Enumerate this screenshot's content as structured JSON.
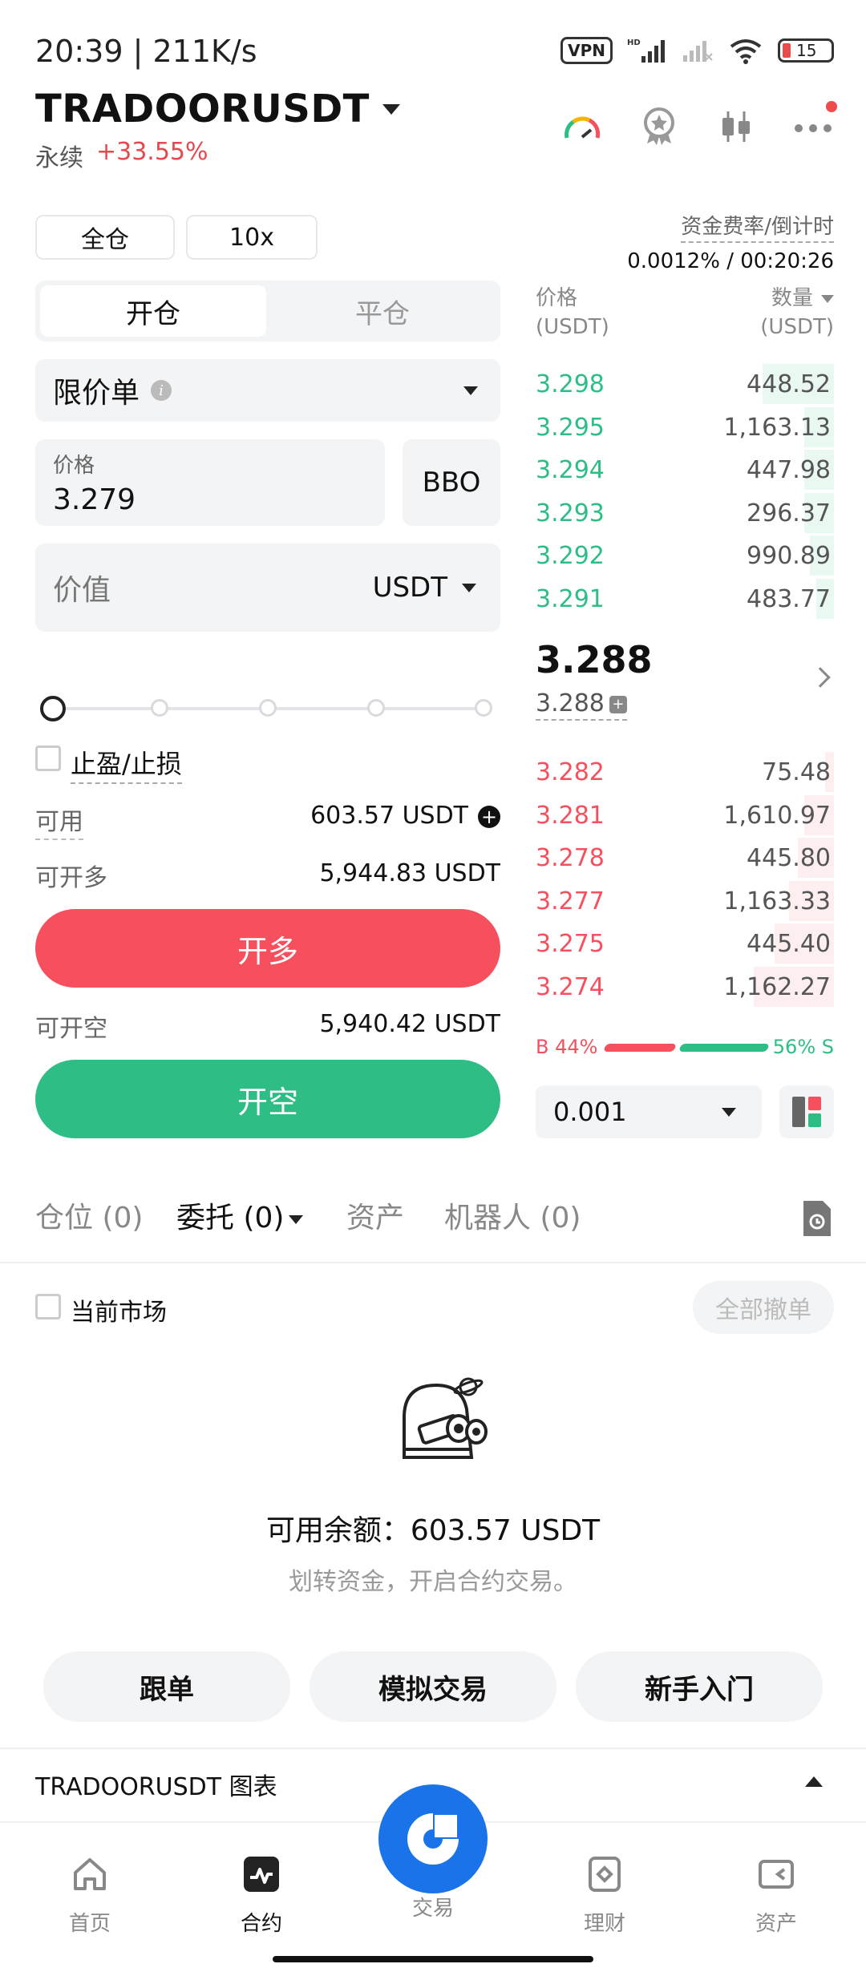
{
  "status_bar": {
    "time": "20:39 | 211K/s",
    "vpn": "VPN",
    "hd": "HD",
    "battery": "15"
  },
  "header": {
    "pair": "TRADOORUSDT",
    "perpetual": "永续",
    "change": "+33.55%"
  },
  "controls": {
    "margin_mode": "全仓",
    "leverage": "10x"
  },
  "funding": {
    "label": "资金费率/倒计时",
    "value": "0.0012% / 00:20:26"
  },
  "form": {
    "tab_open": "开仓",
    "tab_close": "平仓",
    "order_type": "限价单",
    "price_label": "价格",
    "price_value": "3.279",
    "bbo": "BBO",
    "value_placeholder": "价值",
    "value_unit": "USDT",
    "tpsl_label": "止盈/止损",
    "available_label": "可用",
    "available_value": "603.57  USDT",
    "max_long_label": "可开多",
    "max_long_value": "5,944.83 USDT",
    "long_button": "开多",
    "max_short_label": "可开空",
    "max_short_value": "5,940.42 USDT",
    "short_button": "开空"
  },
  "orderbook": {
    "price_header": "价格",
    "price_unit": "(USDT)",
    "qty_header": "数量",
    "qty_unit": "(USDT)",
    "asks": [
      {
        "price": "3.298",
        "qty": "448.52",
        "depth": 0.24
      },
      {
        "price": "3.295",
        "qty": "1,163.13",
        "depth": 0.1
      },
      {
        "price": "3.294",
        "qty": "447.98",
        "depth": 0.1
      },
      {
        "price": "3.293",
        "qty": "296.37",
        "depth": 0.1
      },
      {
        "price": "3.292",
        "qty": "990.89",
        "depth": 0.08
      },
      {
        "price": "3.291",
        "qty": "483.77",
        "depth": 0.06
      }
    ],
    "mid_price": "3.288",
    "mark_price": "3.288",
    "bids": [
      {
        "price": "3.282",
        "qty": "75.48",
        "depth": 0.03
      },
      {
        "price": "3.281",
        "qty": "1,610.97",
        "depth": 0.1
      },
      {
        "price": "3.278",
        "qty": "445.80",
        "depth": 0.12
      },
      {
        "price": "3.277",
        "qty": "1,163.33",
        "depth": 0.15
      },
      {
        "price": "3.275",
        "qty": "445.40",
        "depth": 0.2
      },
      {
        "price": "3.274",
        "qty": "1,162.27",
        "depth": 0.27
      }
    ],
    "buy_ratio": "B 44%",
    "sell_ratio": "56% S",
    "step": "0.001"
  },
  "tabs": [
    {
      "label": "仓位 (0)"
    },
    {
      "label": "委托 (0)"
    },
    {
      "label": "资产"
    },
    {
      "label": "机器人 (0)"
    }
  ],
  "orders": {
    "current_market": "当前市场",
    "cancel_all": "全部撤单",
    "available_balance": "可用余额：603.57 USDT",
    "transfer_tip": "划转资金，开启合约交易。"
  },
  "actions": {
    "copy_trade": "跟单",
    "demo_trade": "模拟交易",
    "beginner": "新手入门"
  },
  "chart_bar": {
    "label": "TRADOORUSDT 图表"
  },
  "nav": {
    "home": "首页",
    "futures": "合约",
    "trade": "交易",
    "earn": "理财",
    "assets": "资产"
  }
}
